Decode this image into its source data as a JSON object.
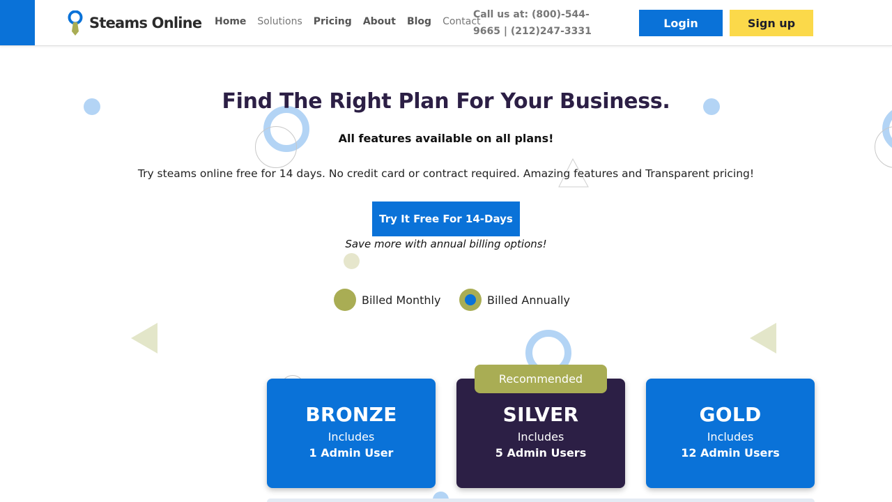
{
  "brand": {
    "name": "Steams Online",
    "accent": "#0a72d8",
    "yellow": "#fbd94a",
    "olive": "#a9ad54",
    "dark": "#2c1f45"
  },
  "nav": {
    "items": [
      {
        "label": "Home"
      },
      {
        "label": "Solutions"
      },
      {
        "label": "Pricing"
      },
      {
        "label": "About"
      },
      {
        "label": "Blog"
      },
      {
        "label": "Contact"
      }
    ],
    "call_text": "Call us at: (800)-544-9665 | (212)247-3331",
    "login_label": "Login",
    "signup_label": "Sign up"
  },
  "hero": {
    "title": "Find The Right Plan For Your Business.",
    "subtitle": "All features available on all plans!",
    "description": "Try steams online free for 14 days. No credit card or contract required. Amazing features and Transparent pricing!",
    "cta_label": "Try It Free For 14-Days",
    "save_note": "Save more with annual billing options!"
  },
  "billing": {
    "monthly_label": "Billed Monthly",
    "annually_label": "Billed Annually",
    "selected": "annually"
  },
  "plans": [
    {
      "name": "BRONZE",
      "includes": "Includes",
      "users": "1 Admin User"
    },
    {
      "name": "SILVER",
      "includes": "Includes",
      "users": "5 Admin Users",
      "badge": "Recommended"
    },
    {
      "name": "GOLD",
      "includes": "Includes",
      "users": "12 Admin Users"
    }
  ]
}
